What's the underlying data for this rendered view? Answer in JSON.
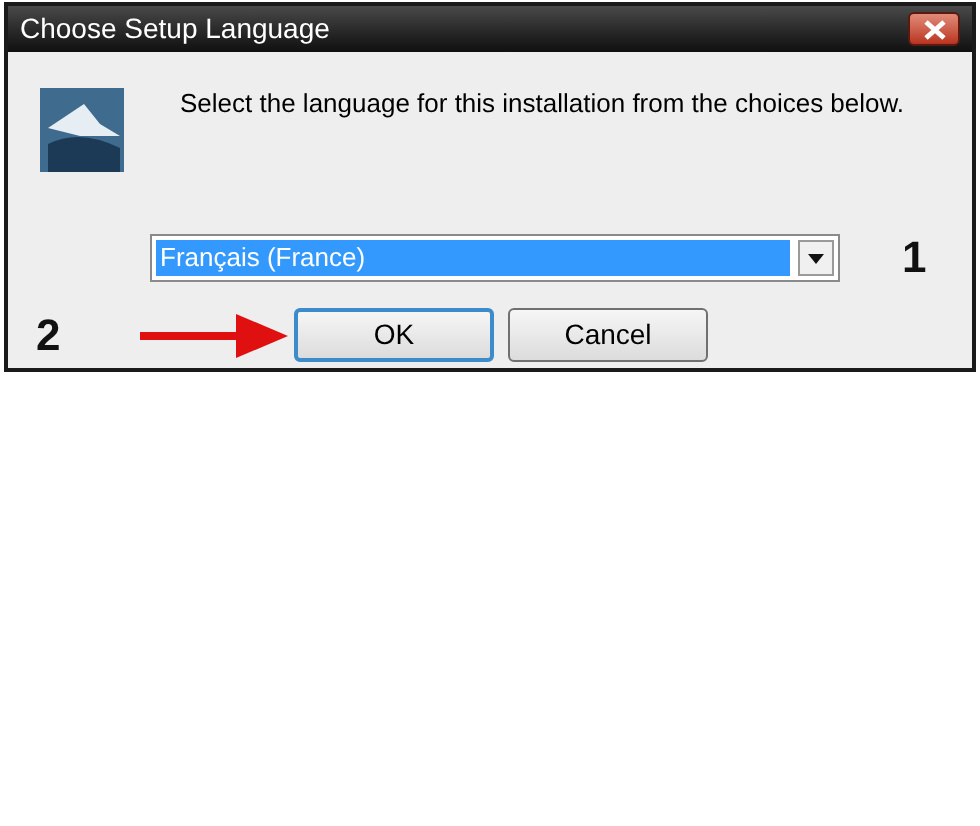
{
  "window": {
    "title": "Choose Setup Language"
  },
  "message": "Select the language for this installation from the choices below.",
  "language_select": {
    "value": "Français (France)",
    "selected": true
  },
  "annotations": [
    "1",
    "2"
  ],
  "buttons": [
    {
      "label": "OK",
      "focused": true
    },
    {
      "label": "Cancel",
      "focused": false
    }
  ]
}
